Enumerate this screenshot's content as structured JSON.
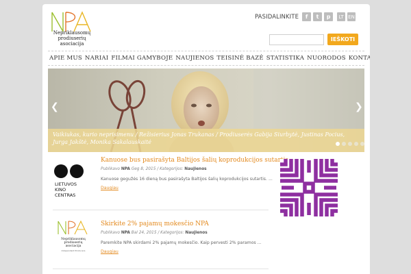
{
  "logo": {
    "text_lines": [
      "Nepriklausomų",
      "prodiuserių",
      "asociacija"
    ]
  },
  "share": {
    "label": "PASIDALINKITE",
    "icons": [
      "facebook-icon",
      "twitter-icon",
      "pinterest-icon"
    ],
    "glyphs": [
      "f",
      "t",
      "p"
    ]
  },
  "languages": [
    "LT",
    "EN"
  ],
  "search": {
    "placeholder": "",
    "button_label": "IEŠKOTI"
  },
  "nav": {
    "items": [
      "APIE MUS",
      "NARIAI",
      "FILMAI GAMYBOJE",
      "NAUJIENOS",
      "TEISINĖ BAZĖ",
      "STATISTIKA",
      "NUORODOS",
      "KONTAKTAI"
    ]
  },
  "slider": {
    "caption": "Vaikiukas, kurio neprisimenu / Režisierius Jonas Trukanas / Prodiuserės Gabija Siurbytė, Justinas Pocius, Jurga Jakštė, Monika Sakalauskaitė",
    "prev": "❮",
    "next": "❯",
    "dots": 5,
    "active_dot": 0
  },
  "news": [
    {
      "title": "Kanuose bus pasirašyta Baltijos šalių koprodukcijos sutartis",
      "meta_prefix": "Publikavo",
      "author": "NPA",
      "date": "Geg 8, 2015",
      "category_prefix": "Kategorijos:",
      "category": "Naujienos",
      "excerpt": "Kanuose gegužės 16 dieną bus pasirašyta Baltijos šalių koprodukcijos sutartis. ...",
      "more": "Daugiau",
      "thumb_text": [
        "LIETUVOS",
        "KINO",
        "CENTRAS"
      ]
    },
    {
      "title": "Skirkite 2% pajamų mokesčio NPA",
      "meta_prefix": "Publikavo",
      "author": "NPA",
      "date": "Bal 24, 2015",
      "category_prefix": "Kategorijos:",
      "category": "Naujienos",
      "excerpt": "Paremkite NPA skirdami 2% pajamų mokesčio. Kaip pervesti 2% paramos ...",
      "more": "Daugiau",
      "thumb_text": [
        "Nepriklausomų",
        "prodiuserių",
        "asociacija",
        "Independent Producers"
      ]
    }
  ],
  "colors": {
    "accent": "#f2a81d",
    "link": "#e3891d",
    "pattern": "#8e2fa0"
  }
}
